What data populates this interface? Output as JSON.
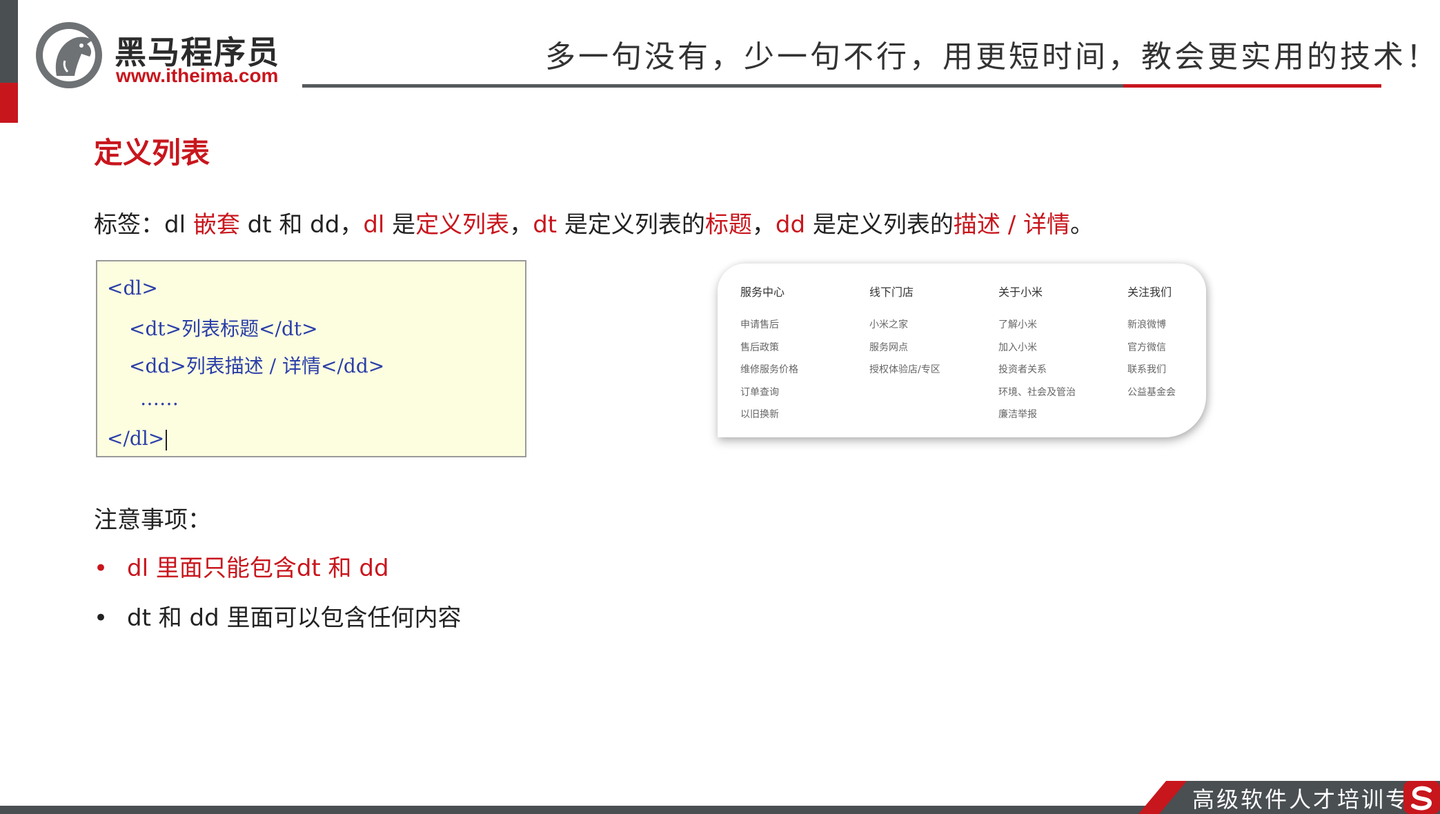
{
  "brand": {
    "name_cn": "黑马程序员",
    "url": "www.itheima.com",
    "slogan": "多一句没有，少一句不行，用更短时间，教会更实用的技术！",
    "colors": {
      "red": "#c8161d",
      "dark_gray": "#4a4f52"
    }
  },
  "title": "定义列表",
  "intro": {
    "p1": "标签：dl ",
    "p2": "嵌套",
    "p3": " dt 和 dd，",
    "p4": "dl",
    "p5": " 是",
    "p6": "定义列表",
    "p7": "，",
    "p8": "dt",
    "p9": " 是定义列表的",
    "p10": "标题",
    "p11": "，",
    "p12": "dd",
    "p13": " 是定义列表的",
    "p14": "描述 / 详情",
    "p15": "。"
  },
  "code": {
    "lines": [
      "<dl>",
      "<dt>列表标题</dt>",
      "<dd>列表描述 / 详情</dd>",
      "……",
      "</dl>"
    ]
  },
  "footer_columns": [
    {
      "heading": "服务中心",
      "links": [
        "申请售后",
        "售后政策",
        "维修服务价格",
        "订单查询",
        "以旧换新"
      ]
    },
    {
      "heading": "线下门店",
      "links": [
        "小米之家",
        "服务网点",
        "授权体验店/专区"
      ]
    },
    {
      "heading": "关于小米",
      "links": [
        "了解小米",
        "加入小米",
        "投资者关系",
        "环境、社会及管治",
        "廉洁举报"
      ]
    },
    {
      "heading": "关注我们",
      "links": [
        "新浪微博",
        "官方微信",
        "联系我们",
        "公益基金会"
      ]
    }
  ],
  "notes": {
    "label": "注意事项：",
    "bullet": "•",
    "items": [
      "dl 里面只能包含dt 和 dd",
      "dt 和 dd 里面可以包含任何内容"
    ]
  },
  "tagline": "高级软件人才培训专家"
}
